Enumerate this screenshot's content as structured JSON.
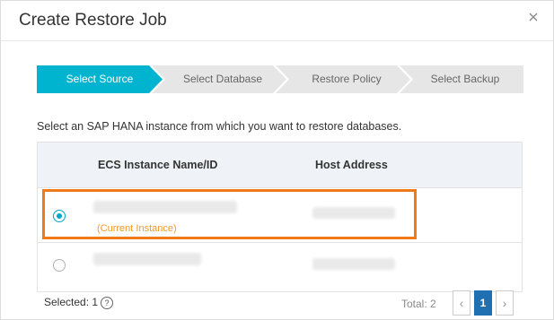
{
  "dialog": {
    "title": "Create Restore Job",
    "close_icon": "close-icon"
  },
  "steps": [
    {
      "label": "Select Source",
      "active": true
    },
    {
      "label": "Select Database",
      "active": false
    },
    {
      "label": "Restore Policy",
      "active": false
    },
    {
      "label": "Select Backup",
      "active": false
    }
  ],
  "intro_text": "Select an SAP HANA instance from which you want to restore databases.",
  "table": {
    "columns": [
      "ECS Instance Name/ID",
      "Host Address"
    ],
    "rows": [
      {
        "selected": true,
        "tag": "(Current Instance)"
      },
      {
        "selected": false,
        "tag": ""
      }
    ]
  },
  "footer": {
    "selected_label": "Selected: 1",
    "help_icon": "help-icon",
    "help_glyph": "?",
    "total_label": "Total: 2",
    "page": "1",
    "prev_glyph": "‹",
    "next_glyph": "›"
  },
  "colors": {
    "step_active": "#00b4d0",
    "step_inactive": "#e6e6e6",
    "highlight_border": "#ee7a1a",
    "current_tag": "#ef9a2e",
    "page_active": "#1f6fb3"
  }
}
